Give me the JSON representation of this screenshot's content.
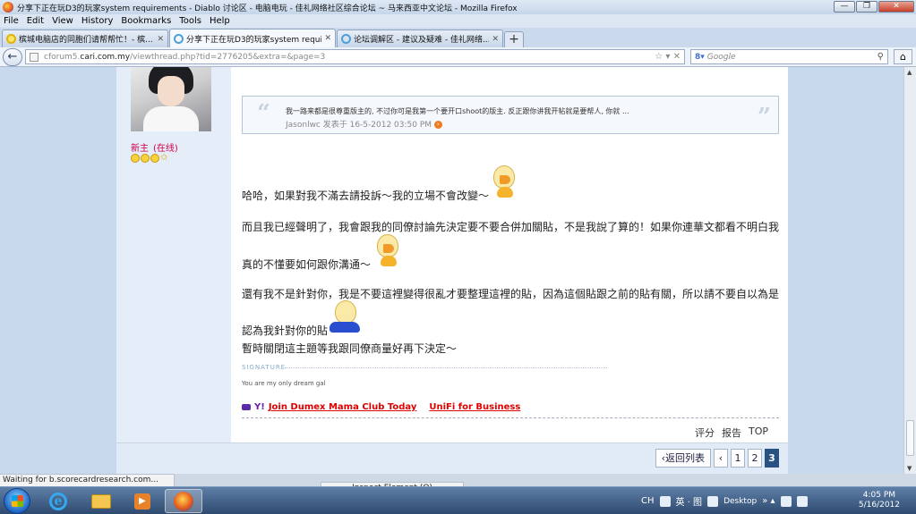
{
  "window": {
    "title": "分享下正在玩D3的玩家system requirements - Diablo 讨论区 - 电脑电玩 - 佳礼网络社区综合论坛 ~ 马来西亚中文论坛 - Mozilla Firefox",
    "min": "—",
    "max": "❐",
    "close": "✕"
  },
  "menu": [
    "File",
    "Edit",
    "View",
    "History",
    "Bookmarks",
    "Tools",
    "Help"
  ],
  "tabs": [
    {
      "label": "槟城电脑店的同胞们请帮帮忙！- 槟...",
      "close": "✕"
    },
    {
      "label": "分享下正在玩D3的玩家system requir...",
      "close": "✕"
    },
    {
      "label": "论坛调解区 - 建议及疑难 - 佳礼网络...",
      "close": "✕"
    }
  ],
  "newtab": "+",
  "nav": {
    "back": "←",
    "url_prefix": "cforum5.",
    "url_domain": "cari.com.my",
    "url_rest": "/viewthread.php?tid=2776205&extra=&page=3",
    "url_icons": "☆ ▾ ✕",
    "search_engine": "8▾",
    "search_placeholder": "Google",
    "search_icon": "⚲",
    "home": "⌂"
  },
  "user": {
    "rank": "新主",
    "online": "(在线)"
  },
  "quote": {
    "open": "“",
    "close": "”",
    "text": "我一路来都是很尊重版主的, 不过你可是我第一个要开口shoot的版主. 反正跟你讲我开帖就是要帮人, 你就 ...",
    "author": "Jasonlwc 发表于 16-5-2012 03:50 PM",
    "go": "›"
  },
  "post": {
    "line1": "哈哈，如果對我不滿去請投訴～我的立場不會改變～",
    "line2": "而且我已經聲明了，我會跟我的同僚討論先決定要不要合併加關貼，不是我說了算的！如果你連華文都看不明白我",
    "line3": "真的不懂要如何跟你溝通～",
    "line4": "還有我不是針對你，我是不要這裡變得很亂才要整理這裡的貼，因為這個貼跟之前的貼有關，所以請不要自以為是",
    "line5": "認為我針對你的貼",
    "line6": "暫時關閉這主題等我跟同僚商量好再下決定～"
  },
  "signature": {
    "label": "SIGNATURE",
    "text": "You are my only dream gal"
  },
  "ads": {
    "y": "Y!",
    "link1": "Join Dumex Mama Club Today",
    "link2": "UniFi for Business"
  },
  "actions": [
    "评分",
    "报告",
    "TOP"
  ],
  "pager": {
    "back": "‹返回列表",
    "prev": "‹",
    "pages": [
      "1",
      "2",
      "3"
    ]
  },
  "status": "Waiting for b.scorecardresearch.com...",
  "inspect": "Inspect Element (Q)",
  "taskbar": {
    "ie": "e",
    "media": "▶",
    "lang": "CH",
    "tray_text": "英 · 图",
    "desktop": "Desktop",
    "chevrons": "» ▴",
    "time": "4:05 PM",
    "date": "5/16/2012"
  }
}
